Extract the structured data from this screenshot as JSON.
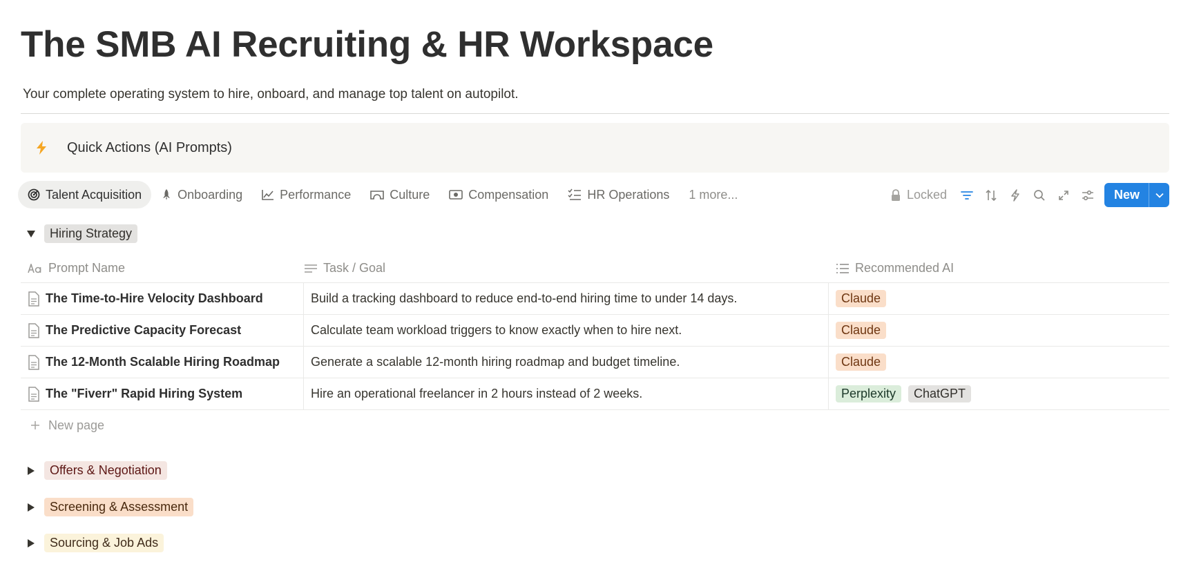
{
  "page": {
    "title": "The SMB AI Recruiting & HR Workspace",
    "subtitle": "Your complete operating system to hire, onboard, and manage top talent on autopilot."
  },
  "callout": {
    "icon": "lightning-icon",
    "label": "Quick Actions (AI Prompts)"
  },
  "tabs": [
    {
      "label": "Talent Acquisition",
      "icon": "target-icon",
      "active": true
    },
    {
      "label": "Onboarding",
      "icon": "rocket-icon"
    },
    {
      "label": "Performance",
      "icon": "line-chart-icon"
    },
    {
      "label": "Culture",
      "icon": "bridge-icon"
    },
    {
      "label": "Compensation",
      "icon": "money-icon"
    },
    {
      "label": "HR Operations",
      "icon": "checklist-icon"
    },
    {
      "label": "1 more..."
    }
  ],
  "toolbar": {
    "locked_label": "Locked",
    "new_label": "New",
    "filter_color": "#2383e2",
    "new_color": "#2383e2"
  },
  "table": {
    "columns": [
      {
        "label": "Prompt Name",
        "icon": "text-aa-icon"
      },
      {
        "label": "Task / Goal",
        "icon": "lines-icon"
      },
      {
        "label": "Recommended AI",
        "icon": "list-icon"
      }
    ],
    "rows": [
      {
        "name": "The Time-to-Hire Velocity Dashboard",
        "task": "Build a tracking dashboard to reduce end-to-end hiring time to under 14 days.",
        "ai": [
          "Claude"
        ]
      },
      {
        "name": "The Predictive Capacity Forecast",
        "task": "Calculate team workload triggers to know exactly when to hire next.",
        "ai": [
          "Claude"
        ]
      },
      {
        "name": "The 12-Month Scalable Hiring Roadmap",
        "task": "Generate a scalable 12-month hiring roadmap and budget timeline.",
        "ai": [
          "Claude"
        ]
      },
      {
        "name": "The \"Fiverr\" Rapid Hiring System",
        "task": "Hire an operational freelancer in 2 hours instead of 2 weeks.",
        "ai": [
          "Perplexity",
          "ChatGPT"
        ]
      }
    ],
    "new_page_label": "New page"
  },
  "groups": [
    {
      "label": "Hiring Strategy",
      "expanded": true,
      "bg": "#e3e2e0",
      "fg": "#32302c"
    },
    {
      "label": "Offers & Negotiation",
      "expanded": false,
      "bg": "#f4e6e2",
      "fg": "#5d1715"
    },
    {
      "label": "Screening & Assessment",
      "expanded": false,
      "bg": "#fadec9",
      "fg": "#49290e"
    },
    {
      "label": "Sourcing & Job Ads",
      "expanded": false,
      "bg": "#fbf3db",
      "fg": "#402c1b"
    }
  ],
  "tag_colors": {
    "Claude": {
      "bg": "#fadec9",
      "fg": "#6e3611"
    },
    "Perplexity": {
      "bg": "#dbeddb",
      "fg": "#1c3829"
    },
    "ChatGPT": {
      "bg": "#e3e2e0",
      "fg": "#32302c"
    }
  }
}
